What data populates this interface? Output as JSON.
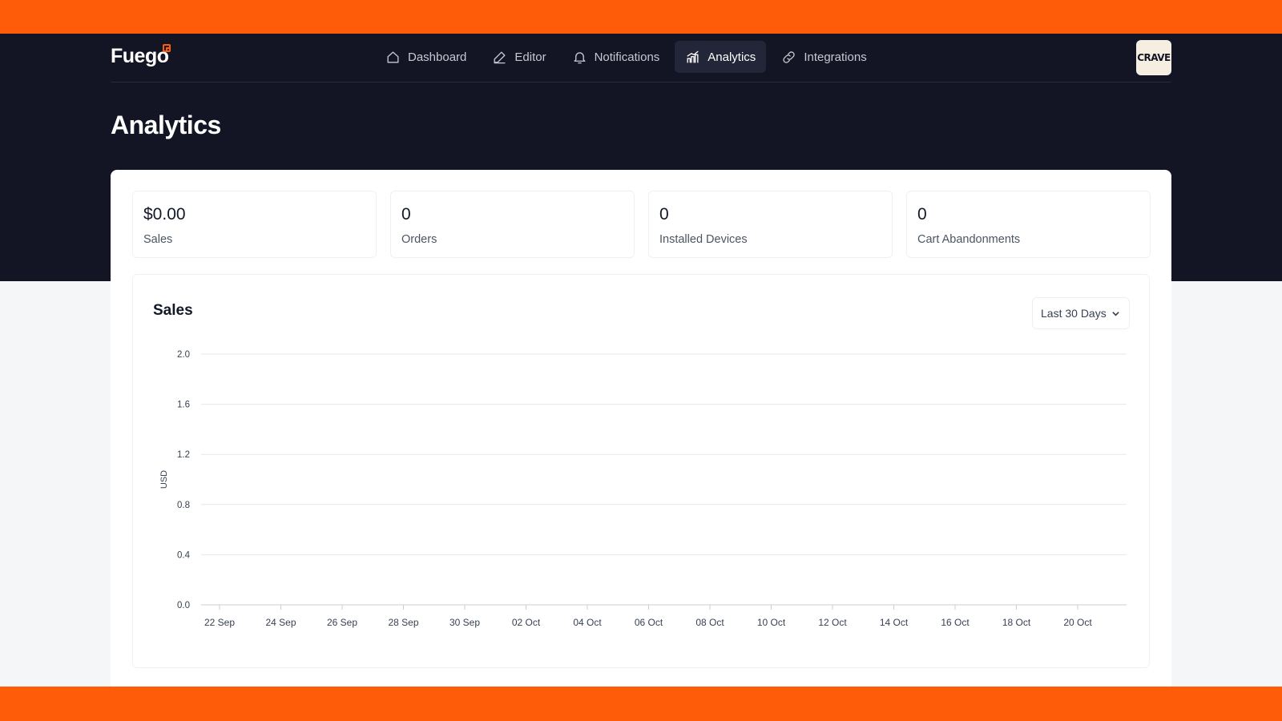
{
  "app": {
    "logo_text": "Fuego",
    "brand_badge": "CRAVE"
  },
  "nav": {
    "items": [
      {
        "label": "Dashboard",
        "icon": "home-icon",
        "active": false
      },
      {
        "label": "Editor",
        "icon": "pencil-icon",
        "active": false
      },
      {
        "label": "Notifications",
        "icon": "bell-icon",
        "active": false
      },
      {
        "label": "Analytics",
        "icon": "bar-chart-icon",
        "active": true
      },
      {
        "label": "Integrations",
        "icon": "link-icon",
        "active": false
      }
    ]
  },
  "page": {
    "title": "Analytics"
  },
  "stats": [
    {
      "value": "$0.00",
      "label": "Sales"
    },
    {
      "value": "0",
      "label": "Orders"
    },
    {
      "value": "0",
      "label": "Installed Devices"
    },
    {
      "value": "0",
      "label": "Cart Abandonments"
    }
  ],
  "sales_panel": {
    "title": "Sales",
    "range_selected": "Last 30 Days"
  },
  "colors": {
    "accent": "#ff5c0a",
    "header_bg": "#131524",
    "nav_active_bg": "#232638"
  },
  "chart_data": {
    "type": "line",
    "title": "Sales",
    "ylabel": "USD",
    "xlabel": "",
    "ylim": [
      0,
      2
    ],
    "yticks": [
      "0.0",
      "0.4",
      "0.8",
      "1.2",
      "1.6",
      "2.0"
    ],
    "x_tick_labels": [
      "22 Sep",
      "24 Sep",
      "26 Sep",
      "28 Sep",
      "30 Sep",
      "02 Oct",
      "04 Oct",
      "06 Oct",
      "08 Oct",
      "10 Oct",
      "12 Oct",
      "14 Oct",
      "16 Oct",
      "18 Oct",
      "20 Oct"
    ],
    "series": [
      {
        "values": []
      }
    ],
    "grid": true
  }
}
